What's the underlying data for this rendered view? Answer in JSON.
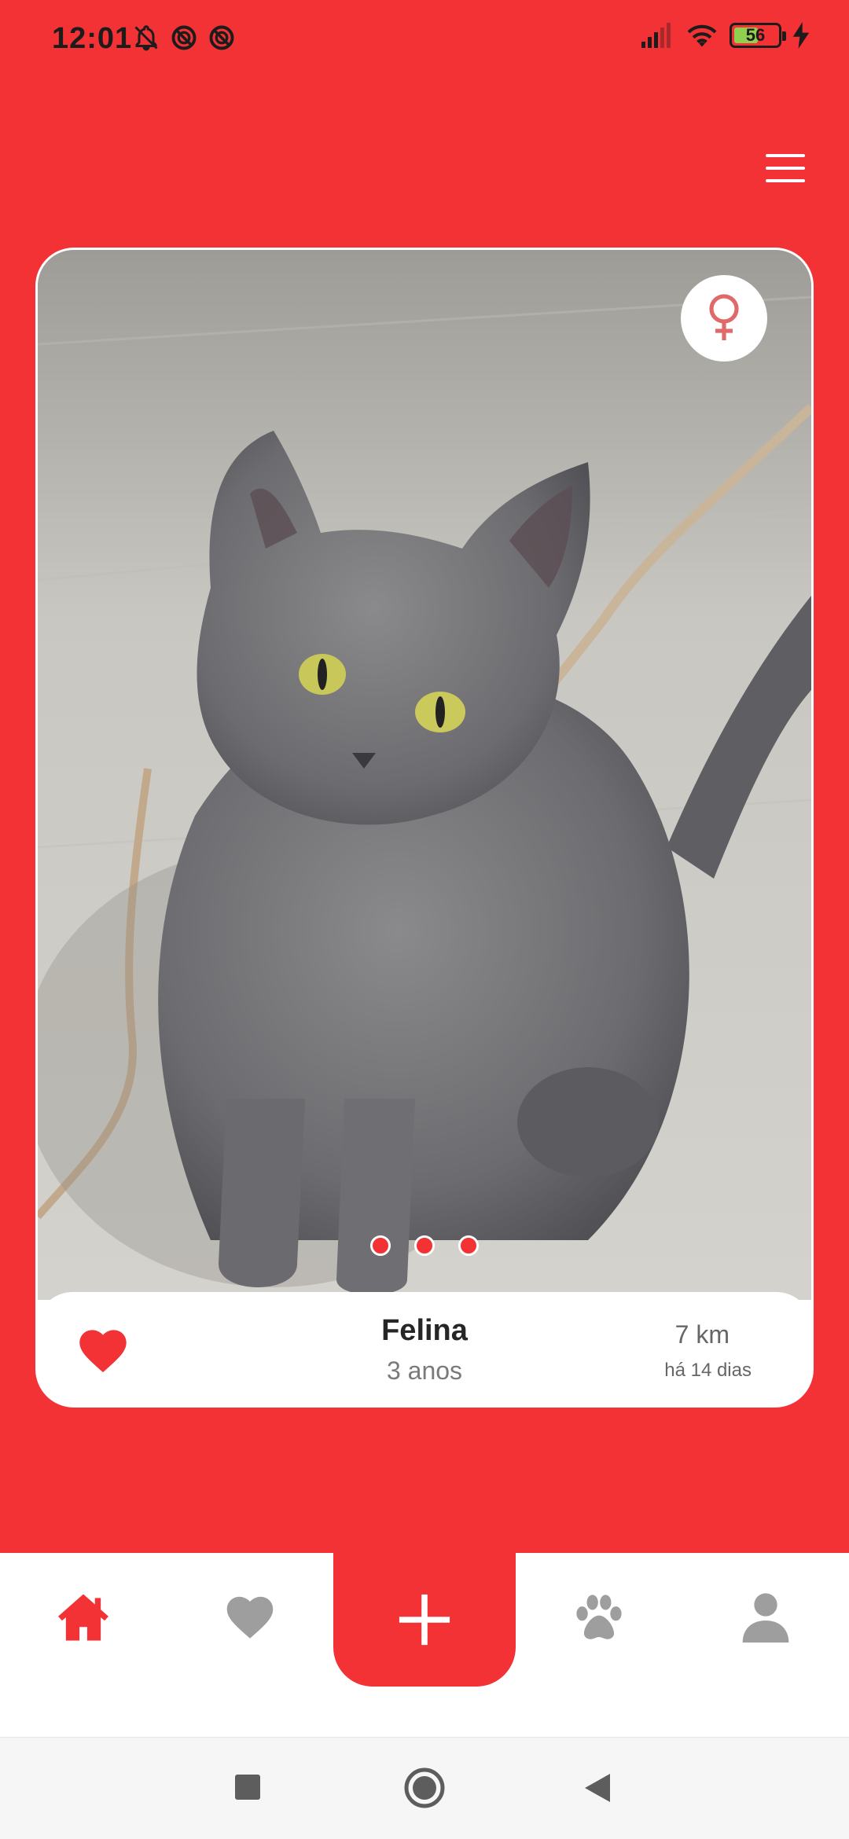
{
  "status_bar": {
    "time": "12:01",
    "battery": "56",
    "battery_level": 0.56,
    "left_icons": [
      "notifications-off-icon",
      "do-not-disturb-icon",
      "do-not-disturb-icon"
    ],
    "right_icons": [
      "signal-icon",
      "wifi-icon",
      "battery-icon",
      "charging-icon"
    ]
  },
  "header": {
    "menu_icon": "hamburger-menu-icon"
  },
  "pet_card": {
    "photo_alt": "gray cat photo",
    "gender_icon": "female-icon",
    "photo_count": 3,
    "active_photo": 1,
    "name": "Felina",
    "age": "3 anos",
    "distance": "7 km",
    "posted": "há 14 dias",
    "like_icon": "heart-icon"
  },
  "bottom_nav": {
    "items": [
      {
        "icon": "home-icon",
        "active": true
      },
      {
        "icon": "heart-icon",
        "active": false
      },
      {
        "icon": "plus-icon",
        "active": false
      },
      {
        "icon": "paw-icon",
        "active": false
      },
      {
        "icon": "user-icon",
        "active": false
      }
    ]
  },
  "system_nav": {
    "items": [
      "recents-icon",
      "home-icon",
      "back-icon"
    ]
  },
  "colors": {
    "accent": "#f33236",
    "inactive_icon": "#9e9e9e",
    "text_dark": "#262626"
  }
}
